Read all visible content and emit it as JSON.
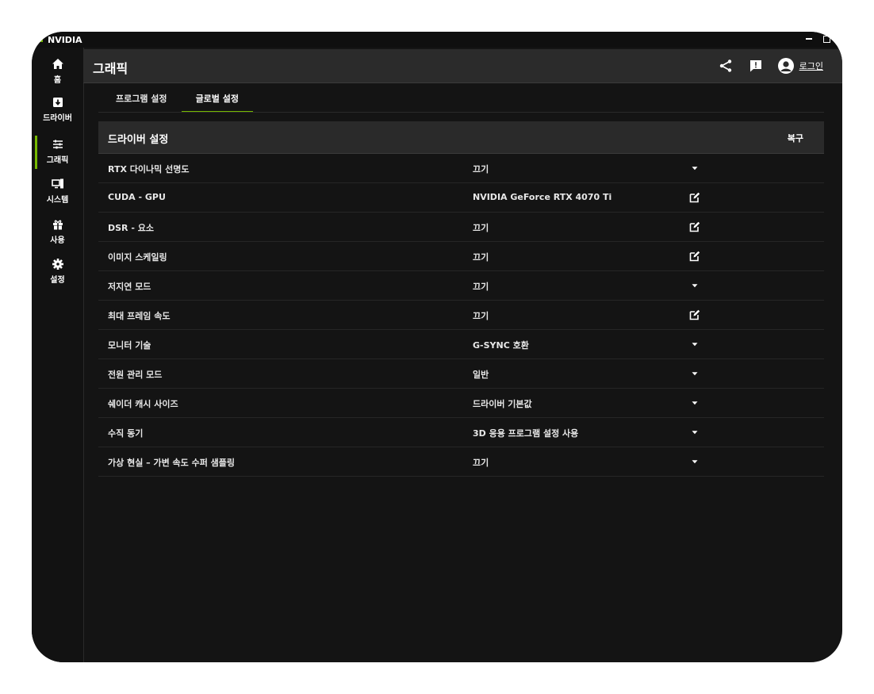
{
  "window": {
    "title": "NVIDIA"
  },
  "sidebar": {
    "items": [
      {
        "label": "홈",
        "icon": "home-icon"
      },
      {
        "label": "드라이버",
        "icon": "driver-icon"
      },
      {
        "label": "그래픽",
        "icon": "graphics-sliders-icon",
        "active": true
      },
      {
        "label": "시스템",
        "icon": "system-icon"
      },
      {
        "label": "사용",
        "icon": "gift-icon"
      },
      {
        "label": "설정",
        "icon": "gear-icon"
      }
    ]
  },
  "header": {
    "title": "그래픽",
    "login_label": "로그인"
  },
  "tabs": [
    {
      "label": "프로그램 설정",
      "active": false
    },
    {
      "label": "글로벌 설정",
      "active": true
    }
  ],
  "panel": {
    "title": "드라이버 설정",
    "restore_label": "복구",
    "rows": [
      {
        "label": "RTX 다이나믹 선명도",
        "value": "끄기",
        "action": "dropdown"
      },
      {
        "label": "CUDA - GPU",
        "value": "NVIDIA GeForce RTX 4070 Ti",
        "action": "edit"
      },
      {
        "label": "DSR - 요소",
        "value": "끄기",
        "action": "edit"
      },
      {
        "label": "이미지 스케일링",
        "value": "끄기",
        "action": "edit"
      },
      {
        "label": "저지연 모드",
        "value": "끄기",
        "action": "dropdown"
      },
      {
        "label": "최대 프레임 속도",
        "value": "끄기",
        "action": "edit"
      },
      {
        "label": "모니터 기술",
        "value": "G-SYNC 호환",
        "action": "dropdown"
      },
      {
        "label": "전원 관리 모드",
        "value": "일반",
        "action": "dropdown"
      },
      {
        "label": "쉐이더 캐시 사이즈",
        "value": "드라이버 기본값",
        "action": "dropdown"
      },
      {
        "label": "수직 동기",
        "value": "3D 응용 프로그램 설정 사용",
        "action": "dropdown"
      },
      {
        "label": "가상 현실 – 가변 속도 수퍼 샘플링",
        "value": "끄기",
        "action": "dropdown"
      }
    ]
  },
  "colors": {
    "accent": "#76b900",
    "background": "#141414",
    "header": "#2b2b2b"
  }
}
